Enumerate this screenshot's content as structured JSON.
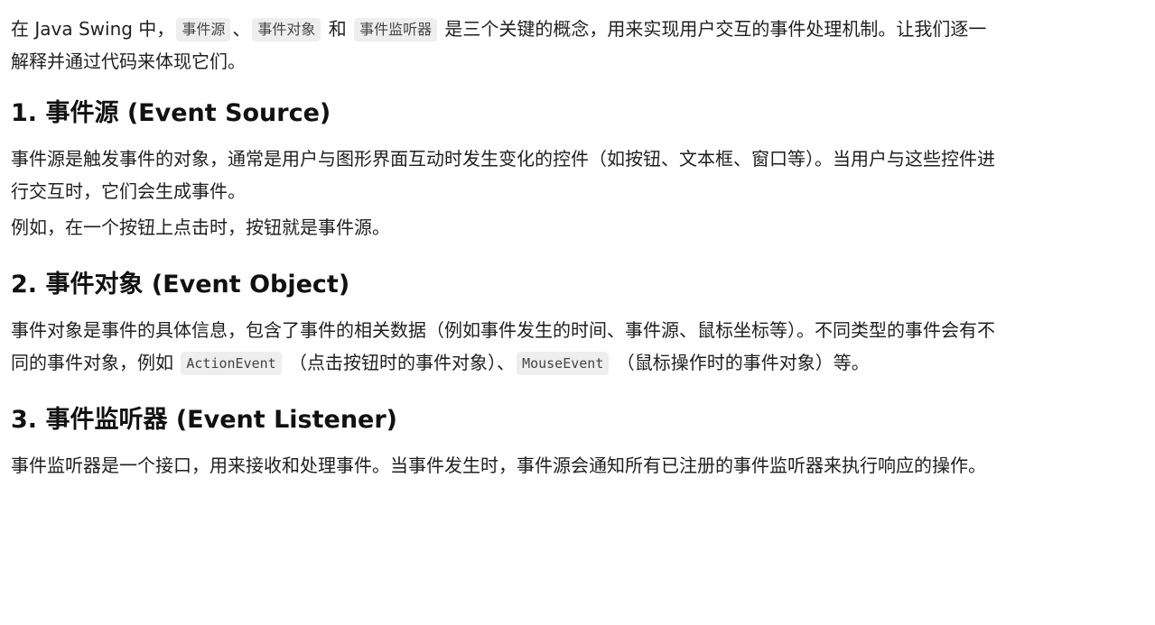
{
  "intro": {
    "t1": "在 Java Swing 中，",
    "code1": "事件源",
    "t2": "、",
    "code2": "事件对象",
    "t3": " 和 ",
    "code3": "事件监听器",
    "t4": " 是三个关键的概念，用来实现用户交互的事件处理机制。让我们逐一解释并通过代码来体现它们。"
  },
  "section1": {
    "title": "1. 事件源 (Event Source)",
    "p1": "事件源是触发事件的对象，通常是用户与图形界面互动时发生变化的控件（如按钮、文本框、窗口等）。当用户与这些控件进行交互时，它们会生成事件。",
    "p2": "例如，在一个按钮上点击时，按钮就是事件源。"
  },
  "section2": {
    "title": "2. 事件对象 (Event Object)",
    "t1": "事件对象是事件的具体信息，包含了事件的相关数据（例如事件发生的时间、事件源、鼠标坐标等）。不同类型的事件会有不同的事件对象，例如 ",
    "code1": "ActionEvent",
    "t2": " （点击按钮时的事件对象）、",
    "code2": "MouseEvent",
    "t3": " （鼠标操作时的事件对象）等。"
  },
  "section3": {
    "title": "3. 事件监听器 (Event Listener)",
    "p1": "事件监听器是一个接口，用来接收和处理事件。当事件发生时，事件源会通知所有已注册的事件监听器来执行响应的操作。"
  }
}
